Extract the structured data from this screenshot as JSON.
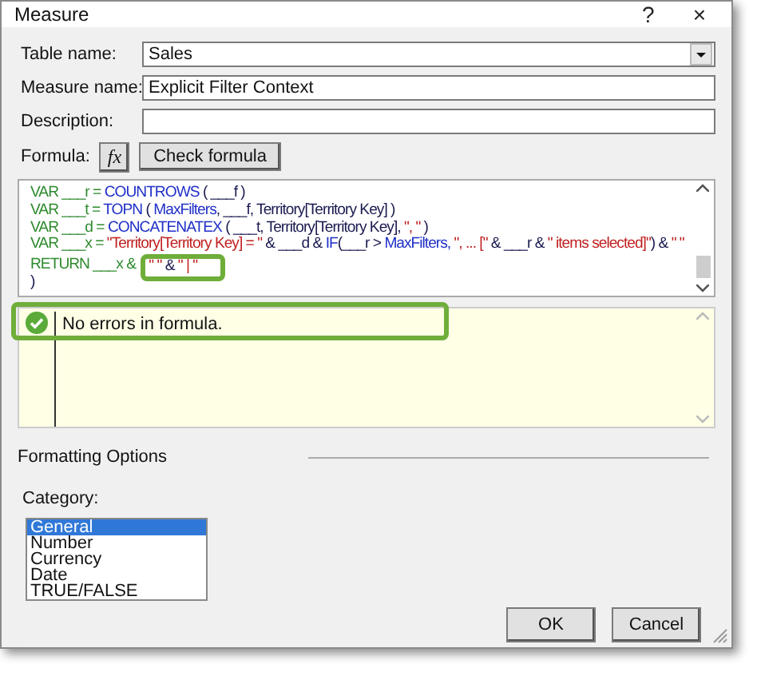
{
  "window": {
    "title": "Measure",
    "help": "?",
    "close": "×"
  },
  "fields": [
    {
      "label": "Table name:",
      "value": "Sales",
      "kind": "dropdown"
    },
    {
      "label": "Measure name:",
      "value": "Explicit Filter Context",
      "kind": "text"
    },
    {
      "label": "Description:",
      "kind": "text"
    }
  ],
  "formula": {
    "label": "Formula:",
    "fx_button": "fx",
    "check_button": "Check formula",
    "code_lines": [
      [
        {
          "kind": "kw",
          "text": "VAR ___r = "
        },
        {
          "kind": "fn",
          "text": "COUNTROWS"
        },
        {
          "kind": "id",
          "text": " ( ___f )"
        }
      ],
      [
        {
          "kind": "kw",
          "text": "VAR ___t = "
        },
        {
          "kind": "fn",
          "text": "TOPN"
        },
        {
          "kind": "id",
          "text": " ( "
        },
        {
          "kind": "fn",
          "text": "MaxFilters"
        },
        {
          "kind": "id",
          "text": ", ___f, Territory[Territory Key] )"
        }
      ],
      [
        {
          "kind": "kw",
          "text": "VAR ___d = "
        },
        {
          "kind": "fn",
          "text": "CONCATENATEX"
        },
        {
          "kind": "id",
          "text": " ( ___t, Territory[Territory Key], "
        },
        {
          "kind": "str",
          "text": "\", \""
        },
        {
          "kind": "id",
          "text": " )"
        }
      ],
      [
        {
          "kind": "kw",
          "text": "VAR ___x = "
        },
        {
          "kind": "str",
          "text": "\"Territory[Territory Key] = \""
        },
        {
          "kind": "id",
          "text": " & ___d & "
        },
        {
          "kind": "fn",
          "text": "IF"
        },
        {
          "kind": "id",
          "text": "(___r > "
        },
        {
          "kind": "fn",
          "text": "MaxFilters, "
        },
        {
          "kind": "str",
          "text": "\", ... [\""
        },
        {
          "kind": "id",
          "text": " & ___r & "
        },
        {
          "kind": "str",
          "text": "\" items selected]\""
        },
        {
          "kind": "id",
          "text": ") & "
        },
        {
          "kind": "str",
          "text": "\" \""
        }
      ],
      [
        {
          "kind": "kw",
          "text": "RETURN ___x & ",
          "highlighted": false
        },
        {
          "kind": "str",
          "text": "\" \"",
          "highlighted": true
        },
        {
          "kind": "id",
          "text": " & ",
          "highlighted": true
        },
        {
          "kind": "str",
          "text": "\" | \"",
          "highlighted": true
        }
      ],
      [
        {
          "kind": "id",
          "text": ")"
        }
      ]
    ],
    "result": "No errors in formula."
  },
  "formatting": {
    "title": "Formatting Options",
    "category_label": "Category:",
    "categories": [
      {
        "label": "General",
        "selected": true
      },
      {
        "label": "Number",
        "selected": false
      },
      {
        "label": "Currency",
        "selected": false
      },
      {
        "label": "Date",
        "selected": false
      },
      {
        "label": "TRUE/FALSE",
        "selected": false
      }
    ]
  },
  "buttons": [
    "OK",
    "Cancel"
  ]
}
